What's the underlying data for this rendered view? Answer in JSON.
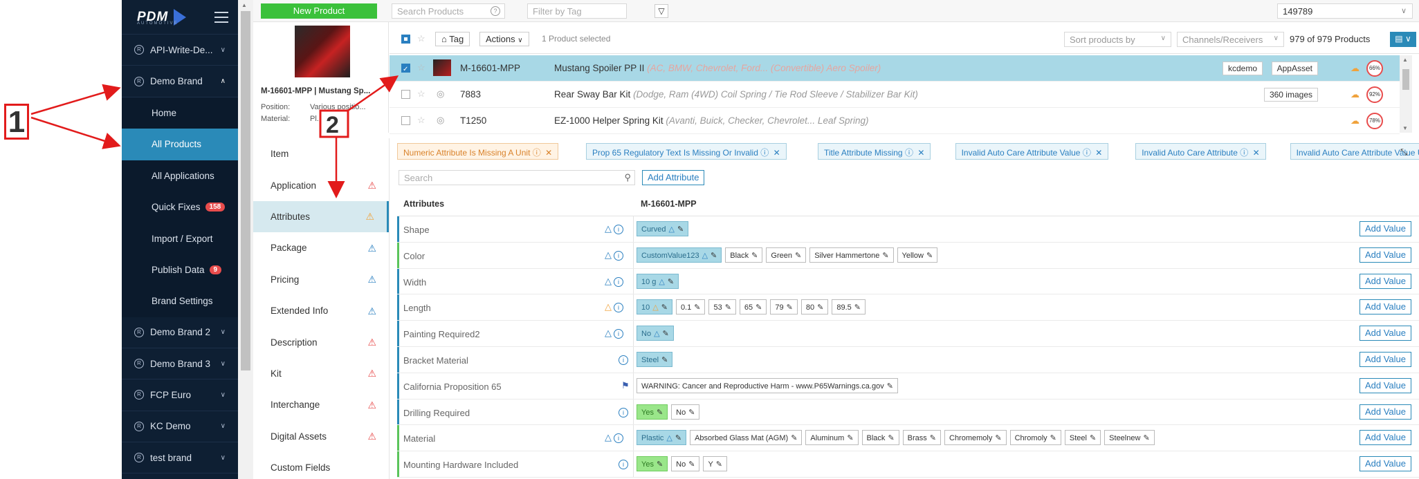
{
  "annotations": {
    "num1": "1",
    "num2": "2"
  },
  "sidebar": {
    "logo": "PDM",
    "logo_sub": "AUTOMOTIVE",
    "items": [
      {
        "label": "API-Write-De...",
        "type": "brand"
      },
      {
        "label": "Demo Brand",
        "type": "brand-open"
      },
      {
        "label": "Home",
        "type": "sub"
      },
      {
        "label": "All Products",
        "type": "sub-active"
      },
      {
        "label": "All Applications",
        "type": "sub"
      },
      {
        "label": "Quick Fixes",
        "type": "sub",
        "badge": "158"
      },
      {
        "label": "Import / Export",
        "type": "sub"
      },
      {
        "label": "Publish Data",
        "type": "sub",
        "badge": "9"
      },
      {
        "label": "Brand Settings",
        "type": "sub"
      },
      {
        "label": "Demo Brand 2",
        "type": "brand"
      },
      {
        "label": "Demo Brand 3",
        "type": "brand"
      },
      {
        "label": "FCP Euro",
        "type": "brand"
      },
      {
        "label": "KC Demo",
        "type": "brand"
      },
      {
        "label": "test brand",
        "type": "brand"
      }
    ]
  },
  "topbar": {
    "new_product": "New Product",
    "search_placeholder": "Search Products",
    "tag_placeholder": "Filter by Tag",
    "brand_select": "149789"
  },
  "product_card": {
    "title": "M-16601-MPP | Mustang Sp...",
    "position_label": "Position:",
    "position_value": "Various positio...",
    "material_label": "Material:",
    "material_value": "Pl..."
  },
  "list_header": {
    "tag": "Tag",
    "actions": "Actions",
    "selected": "1 Product selected",
    "sort": "Sort products by",
    "channels": "Channels/Receivers",
    "count": "979 of 979 Products"
  },
  "products": [
    {
      "pn": "M-16601-MPP",
      "title": "Mustang Spoiler PP II",
      "detail": "(AC, BMW, Chevrolet, Ford... (Convertible) Aero Spoiler)",
      "pills": [
        "kcdemo",
        "AppAsset"
      ],
      "score": "66%"
    },
    {
      "pn": "7883",
      "title": "Rear Sway Bar Kit",
      "detail": "(Dodge, Ram (4WD) Coil Spring / Tie Rod Sleeve / Stabilizer Bar Kit)",
      "pills": [
        "360 images"
      ],
      "score": "92%"
    },
    {
      "pn": "T1250",
      "title": "EZ-1000 Helper Spring Kit",
      "detail": "(Avanti, Buick, Checker, Chevrolet... Leaf Spring)",
      "pills": [],
      "score": "78%"
    }
  ],
  "sections": [
    {
      "label": "Item",
      "warn": ""
    },
    {
      "label": "Application",
      "warn": "red"
    },
    {
      "label": "Attributes",
      "warn": "orange"
    },
    {
      "label": "Package",
      "warn": "blue"
    },
    {
      "label": "Pricing",
      "warn": "blue"
    },
    {
      "label": "Extended Info",
      "warn": "blue"
    },
    {
      "label": "Description",
      "warn": "red"
    },
    {
      "label": "Kit",
      "warn": "red"
    },
    {
      "label": "Interchange",
      "warn": "red"
    },
    {
      "label": "Digital Assets",
      "warn": "red"
    },
    {
      "label": "Custom Fields",
      "warn": ""
    }
  ],
  "chips": [
    {
      "label": "Numeric Attribute Is Missing A Unit",
      "color": "orange"
    },
    {
      "label": "Prop 65 Regulatory Text Is Missing Or Invalid",
      "color": "blue"
    },
    {
      "label": "Title Attribute Missing",
      "color": "blue"
    },
    {
      "label": "Invalid Auto Care Attribute Value",
      "color": "blue"
    },
    {
      "label": "Invalid Auto Care Attribute",
      "color": "blue"
    },
    {
      "label": "Invalid Auto Care Attribute Value UOM",
      "color": "blue"
    }
  ],
  "attr_search_placeholder": "Search",
  "add_attribute": "Add Attribute",
  "attr_header": {
    "col1": "Attributes",
    "col2": "M-16601-MPP"
  },
  "add_value": "Add Value",
  "attributes": [
    {
      "name": "Shape",
      "icons": "tri-info",
      "color": "blue",
      "values": [
        {
          "t": "Curved",
          "s": "blue",
          "w": true
        }
      ]
    },
    {
      "name": "Color",
      "icons": "tri-info",
      "color": "green",
      "values": [
        {
          "t": "CustomValue123",
          "s": "blue",
          "w": true
        },
        {
          "t": "Black"
        },
        {
          "t": "Green"
        },
        {
          "t": "Silver Hammertone"
        },
        {
          "t": "Yellow"
        }
      ]
    },
    {
      "name": "Width",
      "icons": "tri-info",
      "color": "blue",
      "values": [
        {
          "t": "10 g",
          "s": "blue",
          "w": true
        }
      ]
    },
    {
      "name": "Length",
      "icons": "otri-info",
      "color": "blue",
      "values": [
        {
          "t": "10",
          "s": "blue",
          "w": true,
          "o": true
        },
        {
          "t": "0.1"
        },
        {
          "t": "53"
        },
        {
          "t": "65"
        },
        {
          "t": "79"
        },
        {
          "t": "80"
        },
        {
          "t": "89.5"
        }
      ]
    },
    {
      "name": "Painting Required2",
      "icons": "tri-info",
      "color": "blue",
      "values": [
        {
          "t": "No",
          "s": "blue",
          "w": true
        }
      ]
    },
    {
      "name": "Bracket Material",
      "icons": "info",
      "color": "blue",
      "values": [
        {
          "t": "Steel",
          "s": "blue"
        }
      ]
    },
    {
      "name": "California Proposition 65",
      "icons": "flag",
      "color": "blue",
      "values": [
        {
          "t": "WARNING: Cancer and Reproductive Harm - www.P65Warnings.ca.gov"
        }
      ]
    },
    {
      "name": "Drilling Required",
      "icons": "info",
      "color": "blue",
      "values": [
        {
          "t": "Yes",
          "s": "green"
        },
        {
          "t": "No"
        }
      ]
    },
    {
      "name": "Material",
      "icons": "tri-info",
      "color": "green",
      "values": [
        {
          "t": "Plastic",
          "s": "blue",
          "w": true
        },
        {
          "t": "Absorbed Glass Mat (AGM)"
        },
        {
          "t": "Aluminum"
        },
        {
          "t": "Black"
        },
        {
          "t": "Brass"
        },
        {
          "t": "Chromemoly"
        },
        {
          "t": "Chromoly"
        },
        {
          "t": "Steel"
        },
        {
          "t": "Steelnew"
        }
      ]
    },
    {
      "name": "Mounting Hardware Included",
      "icons": "info",
      "color": "green",
      "values": [
        {
          "t": "Yes",
          "s": "green"
        },
        {
          "t": "No"
        },
        {
          "t": "Y"
        }
      ]
    }
  ]
}
